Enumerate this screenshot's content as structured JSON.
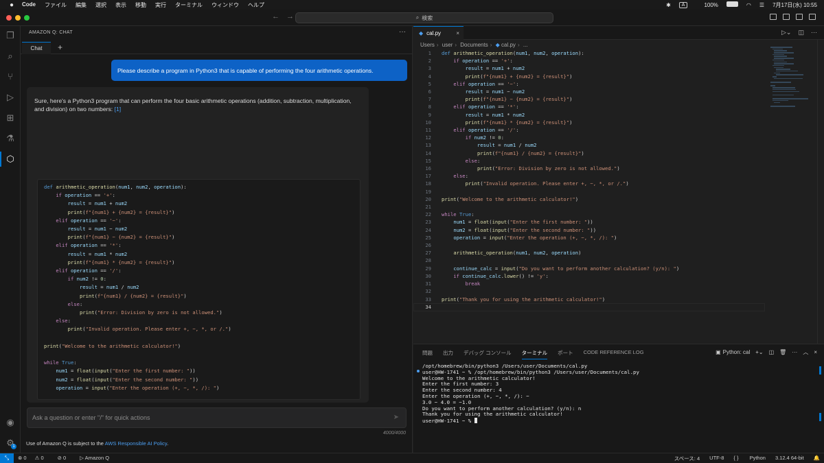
{
  "mac_menubar": {
    "app": "Code",
    "menus": [
      "ファイル",
      "編集",
      "選択",
      "表示",
      "移動",
      "実行",
      "ターミナル",
      "ウィンドウ",
      "ヘルプ"
    ],
    "input_mode": "A",
    "battery": "100%",
    "datetime": "7月17日(水)  10:55"
  },
  "titlebar": {
    "search": "検索",
    "traffic_colors": [
      "#ff5f57",
      "#febc2e",
      "#28c840"
    ]
  },
  "chat": {
    "panel_title": "AMAZON Q: CHAT",
    "tab_label": "Chat",
    "user_message": "Please describe a program in Python3 that is capable of performing the four arithmetic operations.",
    "answer_intro": "Sure, here's a Python3 program that can perform the four basic arithmetic operations (addition, subtraction, multiplication, and division) on two numbers:",
    "answer_ref": "[1]",
    "input_placeholder": "Ask a question or enter \"/\" for quick actions",
    "char_count": "4000/4000",
    "policy_text": "Use of Amazon Q is subject to the",
    "policy_link": "AWS Responsible AI Policy",
    "policy_end": "."
  },
  "editor": {
    "tab_label": "cal.py",
    "breadcrumb": [
      "Users",
      "user",
      "Documents",
      "cal.py",
      "..."
    ],
    "current_line": "34"
  },
  "code": [
    "def arithmetic_operation(num1, num2, operation):",
    "    if operation == '+':",
    "        result = num1 + num2",
    "        print(f\"{num1} + {num2} = {result}\")",
    "    elif operation == '−':",
    "        result = num1 − num2",
    "        print(f\"{num1} − {num2} = {result}\")",
    "    elif operation == '*':",
    "        result = num1 * num2",
    "        print(f\"{num1} * {num2} = {result}\")",
    "    elif operation == '/':",
    "        if num2 != 0:",
    "            result = num1 / num2",
    "            print(f\"{num1} / {num2} = {result}\")",
    "        else:",
    "            print(\"Error: Division by zero is not allowed.\")",
    "    else:",
    "        print(\"Invalid operation. Please enter +, −, *, or /.\")",
    "",
    "print(\"Welcome to the arithmetic calculator!\")",
    "",
    "while True:",
    "    num1 = float(input(\"Enter the first number: \"))",
    "    num2 = float(input(\"Enter the second number: \"))",
    "    operation = input(\"Enter the operation (+, −, *, /): \")",
    "",
    "    arithmetic_operation(num1, num2, operation)",
    "",
    "    continue_calc = input(\"Do you want to perform another calculation? (y/n): \")",
    "    if continue_calc.lower() != 'y':",
    "        break",
    "",
    "print(\"Thank you for using the arithmetic calculator!\")",
    ""
  ],
  "panel": {
    "tabs": [
      "問題",
      "出力",
      "デバッグ コンソール",
      "ターミナル",
      "ポート",
      "CODE REFERENCE LOG"
    ],
    "active_tab": "ターミナル",
    "terminal_name": "Python: cal",
    "terminal_lines": [
      "/opt/homebrew/bin/python3 /Users/user/Documents/cal.py",
      "user@HW-1741 ~ % /opt/homebrew/bin/python3 /Users/user/Documents/cal.py",
      "Welcome to the arithmetic calculator!",
      "Enter the first number: 3",
      "Enter the second number: 4",
      "Enter the operation (+, −, *, /): −",
      "3.0 − 4.0 = −1.0",
      "Do you want to perform another calculation? (y/n): n",
      "Thank you for using the arithmetic calculator!",
      "user@HW-1741 ~ % "
    ]
  },
  "status": {
    "errors": "0",
    "warnings": "0",
    "ports": "0",
    "amazon_q": "Amazon Q",
    "spaces": "スペース: 4",
    "encoding": "UTF-8",
    "language": "Python",
    "interpreter": "3.12.4 64-bit"
  },
  "colors": {
    "accent": "#0078d4",
    "user_bubble": "#0d62c6"
  }
}
